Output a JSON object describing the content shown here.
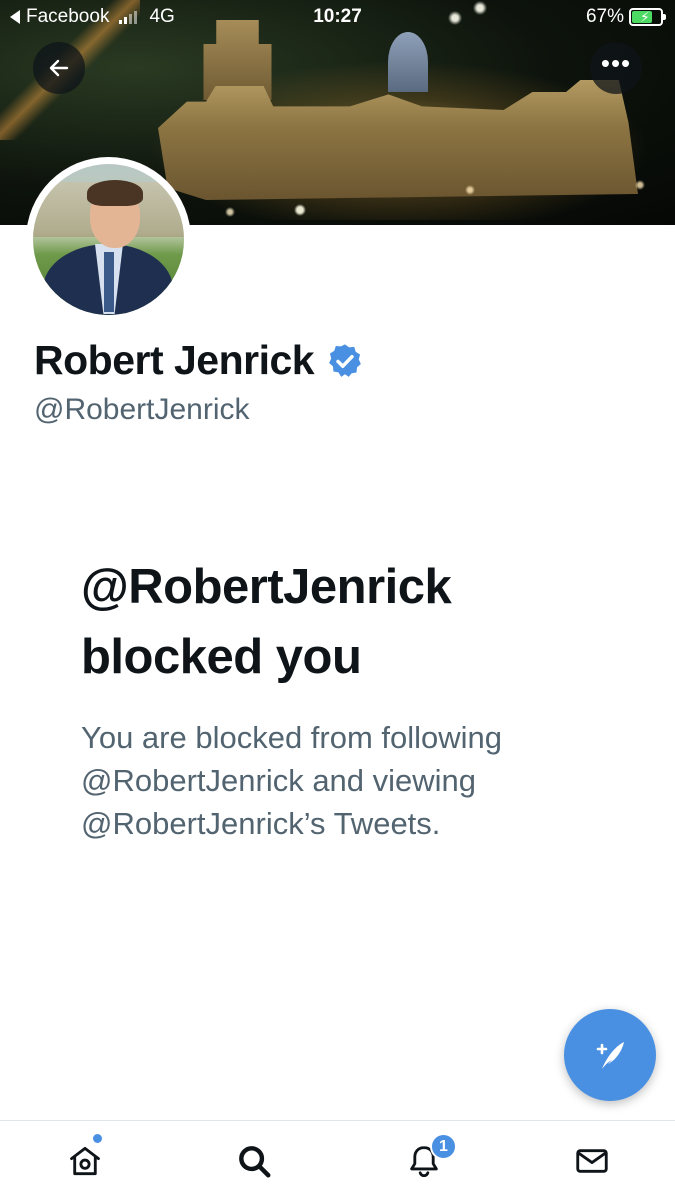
{
  "status_bar": {
    "back_app": "Facebook",
    "network": "4G",
    "time": "10:27",
    "battery": "67%",
    "battery_level": 0.67
  },
  "header": {
    "back_icon": "arrow-left-icon",
    "more_icon": "more-horizontal-icon",
    "more_label": "•••"
  },
  "profile": {
    "display_name": "Robert Jenrick",
    "handle": "@RobertJenrick",
    "verified_icon": "verified-badge-icon"
  },
  "blocked": {
    "title": "@RobertJenrick blocked you",
    "body": "You are blocked from following @RobertJenrick and viewing @RobertJenrick’s Tweets."
  },
  "fab": {
    "icon": "compose-tweet-icon",
    "label": "+"
  },
  "tabbar": {
    "items": [
      {
        "name": "home",
        "icon": "home-icon"
      },
      {
        "name": "search",
        "icon": "search-icon"
      },
      {
        "name": "notifications",
        "icon": "bell-icon"
      },
      {
        "name": "messages",
        "icon": "mail-icon"
      }
    ],
    "notifications_badge": "1"
  },
  "colors": {
    "accent": "#4a90e2",
    "text_primary": "#0f1419",
    "text_secondary": "#536471"
  }
}
